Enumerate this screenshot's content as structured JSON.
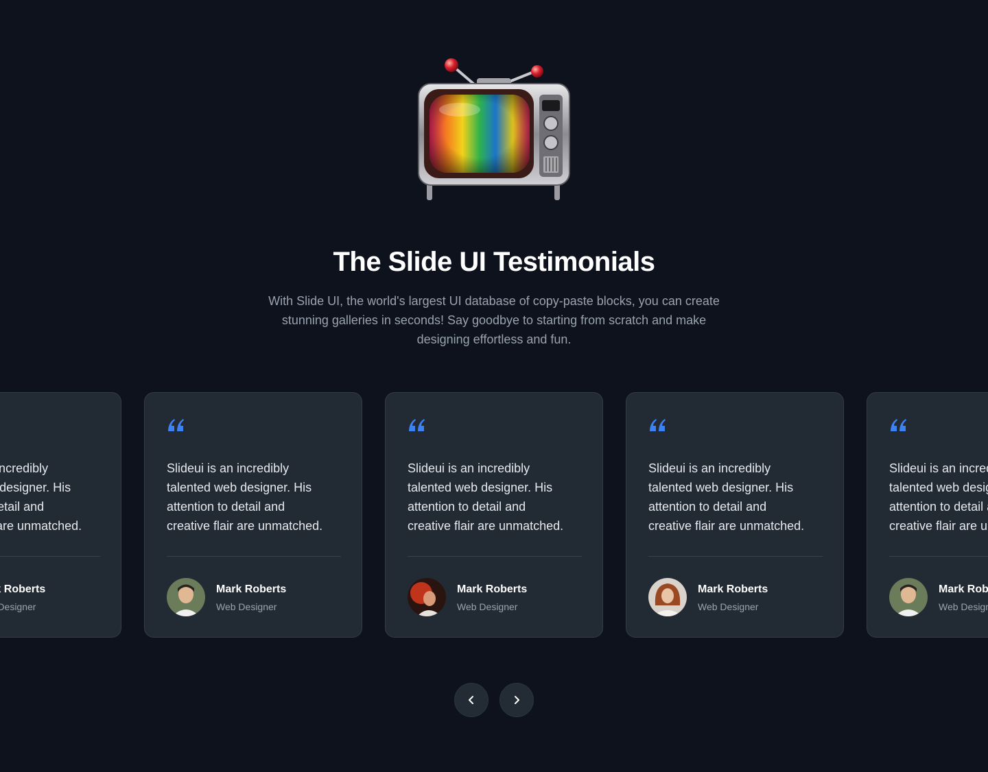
{
  "header": {
    "title": "The Slide UI Testimonials",
    "subtitle": "With Slide UI, the world's largest UI database of copy-paste blocks, you can create stunning galleries in seconds! Say goodbye to starting from scratch and make designing effortless and fun."
  },
  "colors": {
    "background": "#0d121c",
    "card": "#222a33",
    "quote_accent": "#3b82f6",
    "muted_text": "#9aa3b0"
  },
  "testimonials": [
    {
      "quote": "Slideui is an incredibly\ntalented web designer. His\nattention to detail and\ncreative flair are unmatched.",
      "name": "Mark Roberts",
      "role": "Web Designer",
      "avatar": "man-portrait-avatar"
    },
    {
      "quote": "Slideui is an incredibly\ntalented web designer. His\nattention to detail and\ncreative flair are unmatched.",
      "name": "Mark Roberts",
      "role": "Web Designer",
      "avatar": "man-portrait-avatar"
    },
    {
      "quote": "Slideui is an incredibly\ntalented web designer. His\nattention to detail and\ncreative flair are unmatched.",
      "name": "Mark Roberts",
      "role": "Web Designer",
      "avatar": "red-portrait-avatar"
    },
    {
      "quote": "Slideui is an incredibly\ntalented web designer. His\nattention to detail and\ncreative flair are unmatched.",
      "name": "Mark Roberts",
      "role": "Web Designer",
      "avatar": "woman-portrait-avatar"
    },
    {
      "quote": "Slideui is an incredibly\ntalented web designer. His\nattention to detail and\ncreative flair are unmatched.",
      "name": "Mark Roberts",
      "role": "Web Designer",
      "avatar": "man-portrait-avatar"
    }
  ],
  "navigation": {
    "prev_icon": "chevron-left-icon",
    "next_icon": "chevron-right-icon"
  }
}
